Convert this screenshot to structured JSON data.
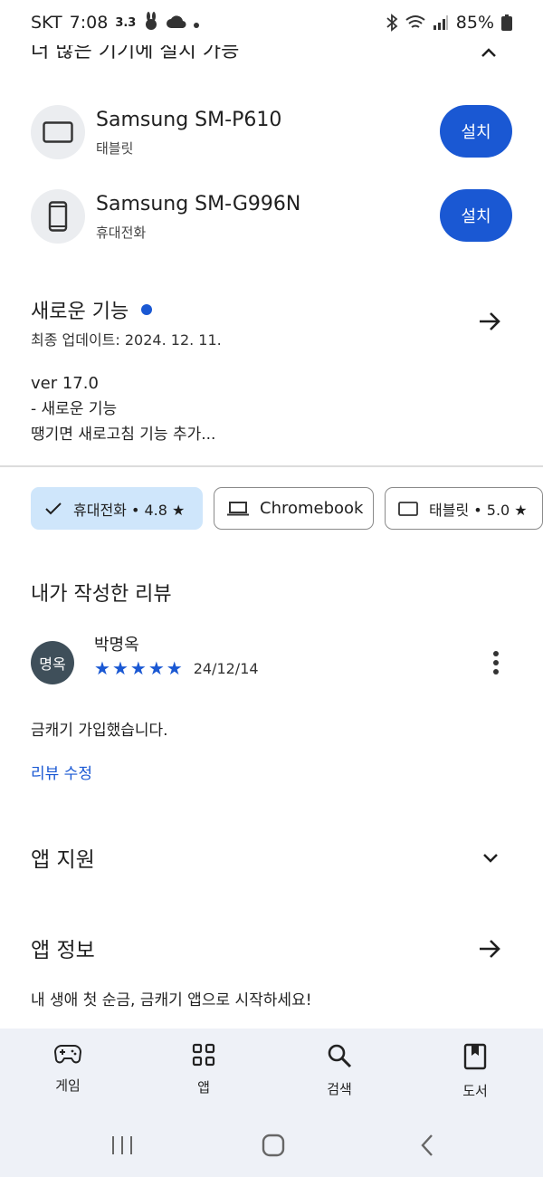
{
  "status_bar": {
    "carrier": "SKT",
    "time": "7:08",
    "indicator": "3.3",
    "battery": "85%"
  },
  "install_section": {
    "title": "더 많은 기기에 설치 가능",
    "devices": [
      {
        "name": "Samsung SM-P610",
        "type": "태블릿",
        "button": "설치",
        "icon": "tablet-icon"
      },
      {
        "name": "Samsung SM-G996N",
        "type": "휴대전화",
        "button": "설치",
        "icon": "phone-icon"
      }
    ]
  },
  "whats_new": {
    "title": "새로운 기능",
    "updated": "최종 업데이트: 2024. 12. 11.",
    "version": "ver 17.0",
    "line1": "- 새로운 기능",
    "line2": "땡기면 새로고침 기능 추가..."
  },
  "device_chips": [
    {
      "label": "휴대전화 • 4.8 ★",
      "selected": true,
      "icon": "check-icon"
    },
    {
      "label": "Chromebook",
      "selected": false,
      "icon": "laptop-icon"
    },
    {
      "label": "태블릿 • 5.0 ★",
      "selected": false,
      "icon": "tablet-icon"
    }
  ],
  "my_review": {
    "title": "내가 작성한 리뷰",
    "avatar_text": "명옥",
    "reviewer": "박명옥",
    "rating": 5,
    "date": "24/12/14",
    "body": "금캐기 가입했습니다.",
    "edit_label": "리뷰 수정"
  },
  "app_support": {
    "title": "앱 지원"
  },
  "app_info": {
    "title": "앱 정보",
    "description": "내 생애 첫 순금, 금캐기 앱으로 시작하세요!"
  },
  "bottom_nav": [
    {
      "label": "게임",
      "icon": "gamepad-icon"
    },
    {
      "label": "앱",
      "icon": "apps-grid-icon"
    },
    {
      "label": "검색",
      "icon": "search-icon"
    },
    {
      "label": "도서",
      "icon": "book-icon"
    }
  ],
  "colors": {
    "accent": "#1a58d3",
    "chip_selected": "#cfe6fb",
    "nav_bg": "#eef1f7"
  }
}
